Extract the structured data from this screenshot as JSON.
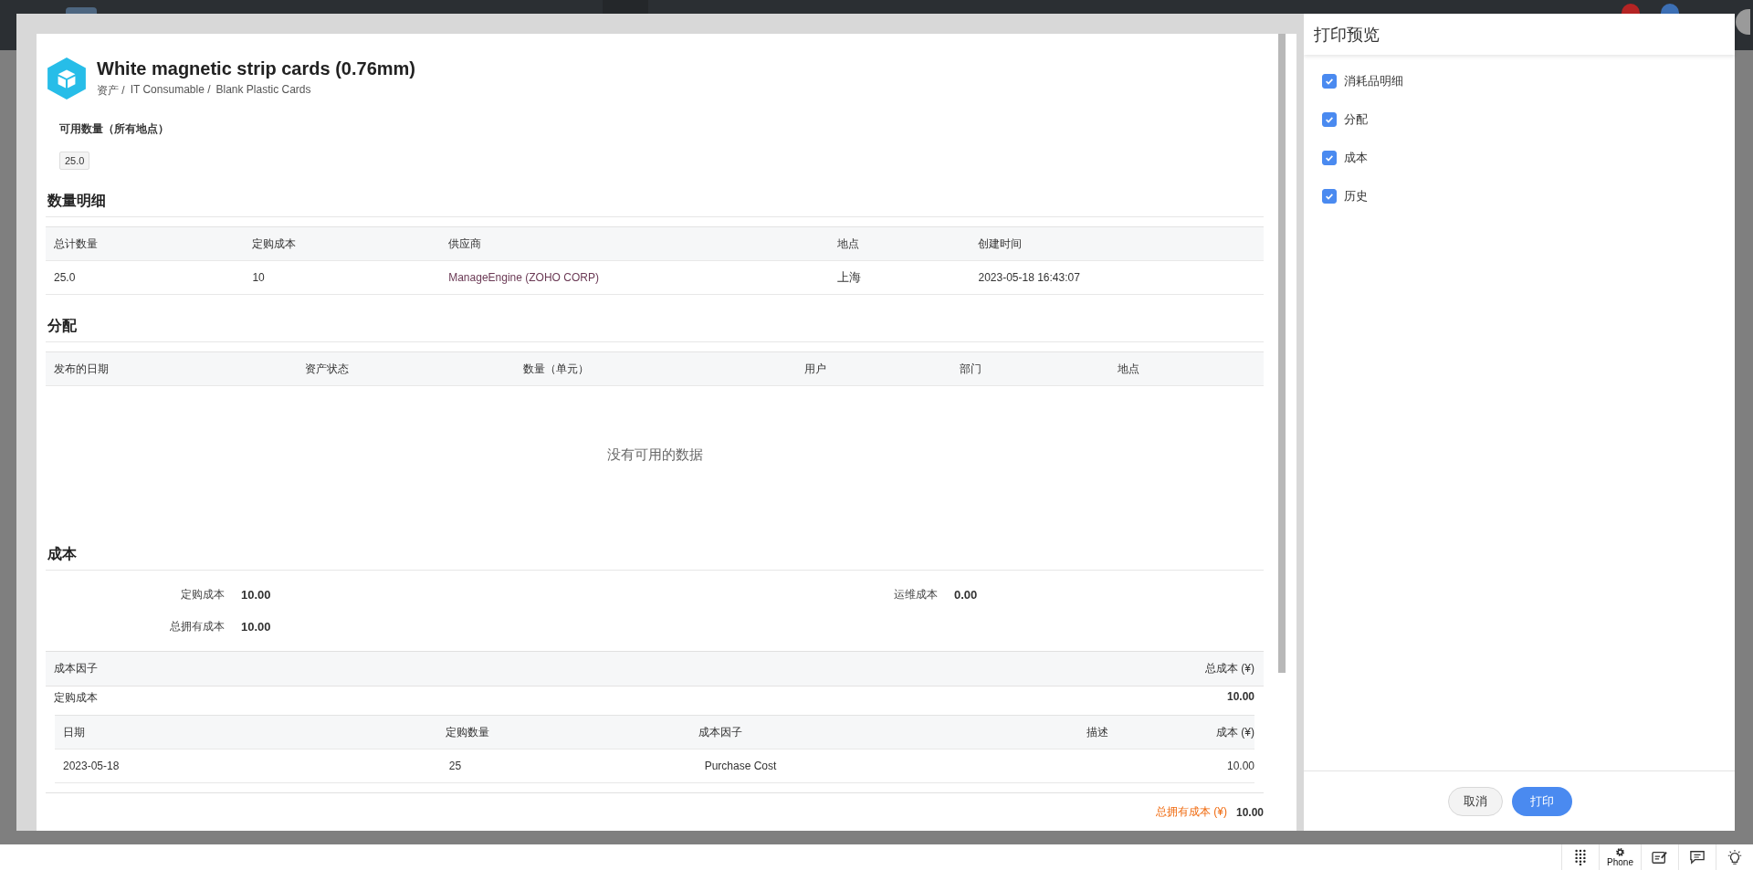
{
  "top_bar": {
    "badges": [
      {
        "color": "#b52424"
      },
      {
        "color": "#3c6fb4"
      }
    ]
  },
  "document": {
    "title": "White magnetic strip cards (0.76mm)",
    "breadcrumb": [
      "资产 /",
      "IT Consumable /",
      "Blank Plastic Cards"
    ],
    "available_label": "可用数量（所有地点）",
    "available_value": "25.0",
    "quantity": {
      "heading": "数量明细",
      "columns": [
        "总计数量",
        "定购成本",
        "供应商",
        "地点",
        "创建时间"
      ],
      "rows": [
        [
          "25.0",
          "10",
          "ManageEngine (ZOHO CORP)",
          "上海",
          "2023-05-18 16:43:07"
        ]
      ]
    },
    "allocation": {
      "heading": "分配",
      "columns": [
        "发布的日期",
        "资产状态",
        "数量（单元）",
        "用户",
        "部门",
        "地点"
      ],
      "empty_message": "没有可用的数据"
    },
    "cost": {
      "heading": "成本",
      "summary": [
        {
          "label": "定购成本",
          "value": "10.00"
        },
        {
          "label": "运维成本",
          "value": "0.00"
        },
        {
          "label": "总拥有成本",
          "value": "10.00"
        }
      ],
      "factor_header": [
        "成本因子",
        "总成本 (¥)"
      ],
      "groups": [
        {
          "name": "定购成本",
          "total": "10.00",
          "columns": [
            "日期",
            "定购数量",
            "成本因子",
            "描述",
            "成本 (¥)"
          ],
          "rows": [
            [
              "2023-05-18",
              "25",
              "Purchase Cost",
              "",
              "10.00"
            ]
          ]
        }
      ],
      "total": {
        "label": "总拥有成本 (¥)",
        "value": "10.00"
      }
    }
  },
  "print_panel": {
    "title": "打印预览",
    "options": [
      {
        "label": "消耗品明细",
        "checked": true
      },
      {
        "label": "分配",
        "checked": true
      },
      {
        "label": "成本",
        "checked": true
      },
      {
        "label": "历史",
        "checked": true
      }
    ],
    "buttons": {
      "cancel": "取消",
      "print": "打印"
    }
  },
  "bottom_bar": {
    "phone_label": "Phone"
  }
}
